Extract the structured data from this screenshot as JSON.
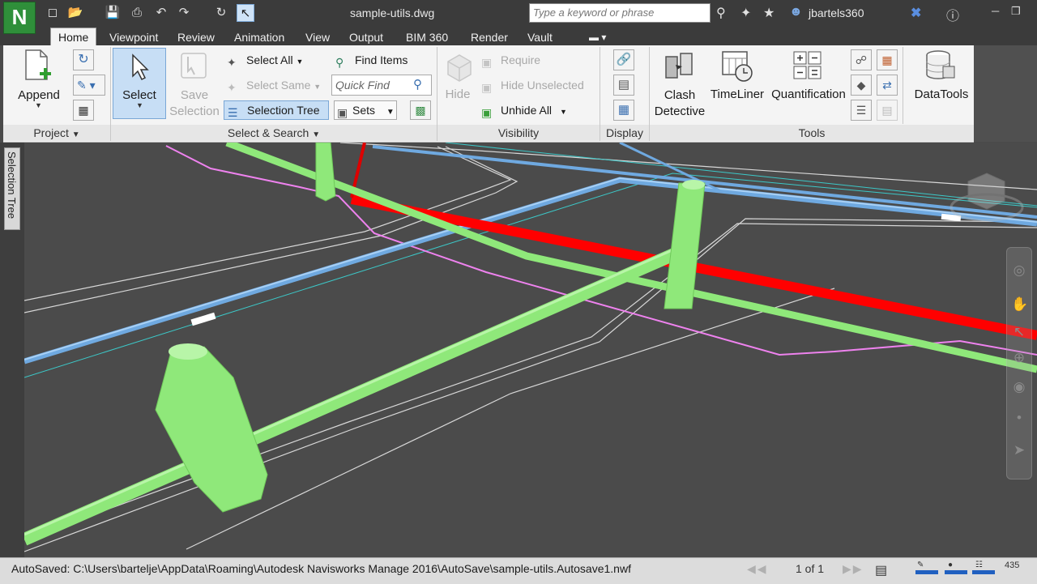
{
  "app": {
    "logo_letter": "N",
    "doc_title": "sample-utils.dwg",
    "search_placeholder": "Type a keyword or phrase",
    "user": "jbartels360"
  },
  "tabs": [
    "Home",
    "Viewpoint",
    "Review",
    "Animation",
    "View",
    "Output",
    "BIM 360",
    "Render",
    "Vault"
  ],
  "ribbon": {
    "project": {
      "append": "Append",
      "label": "Project"
    },
    "select_search": {
      "select": "Select",
      "save_selection": "Save Selection",
      "save_line1": "Save",
      "save_line2": "Selection",
      "select_all": "Select All",
      "select_same": "Select Same",
      "selection_tree": "Selection Tree",
      "find_items": "Find Items",
      "quick_find_placeholder": "Quick Find",
      "sets": "Sets",
      "label": "Select & Search"
    },
    "visibility": {
      "hide": "Hide",
      "require": "Require",
      "hide_unselected": "Hide Unselected",
      "unhide_all": "Unhide All",
      "label": "Visibility"
    },
    "display": {
      "label": "Display"
    },
    "tools": {
      "clash_line1": "Clash",
      "clash_line2": "Detective",
      "timeliner": "TimeLiner",
      "quantification": "Quantification",
      "label": "Tools"
    },
    "datatools": "DataTools"
  },
  "side_tab": "Selection Tree",
  "status": {
    "text": "AutoSaved: C:\\Users\\bartelje\\AppData\\Roaming\\Autodesk Navisworks Manage 2016\\AutoSave\\sample-utils.Autosave1.nwf",
    "page": "1 of 1",
    "mem": "435"
  },
  "colors": {
    "pipe_green": "#8fe87a",
    "pipe_red": "#ff0000",
    "pipe_blue": "#7fb8ee",
    "line_magenta": "#ee82ee",
    "line_cyan": "#3cc8c8",
    "background": "#4b4b4b"
  }
}
